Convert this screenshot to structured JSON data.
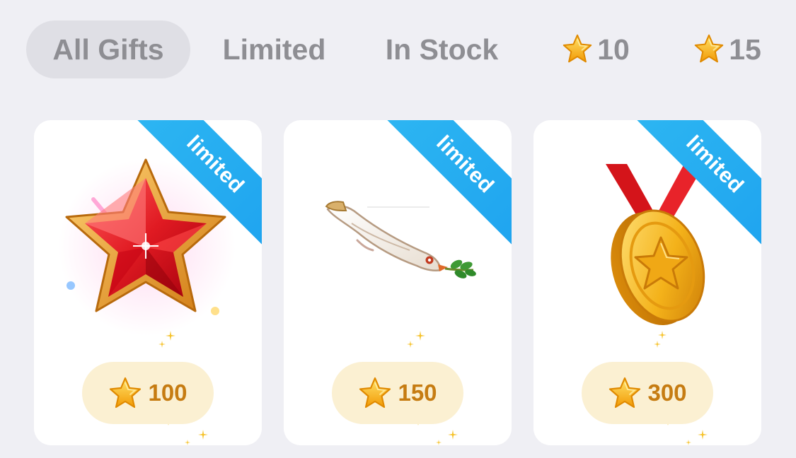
{
  "tabs": {
    "all_gifts": "All Gifts",
    "limited": "Limited",
    "in_stock": "In Stock",
    "star_10": "10",
    "star_15": "15"
  },
  "gifts": [
    {
      "badge": "limited",
      "price": "100",
      "item": "red-star-icon"
    },
    {
      "badge": "limited",
      "price": "150",
      "item": "dove-icon"
    },
    {
      "badge": "limited",
      "price": "300",
      "item": "gold-medal-icon"
    }
  ],
  "colors": {
    "background": "#efeff4",
    "active_tab": "#dfdfe5",
    "tab_text": "#8e8e93",
    "ribbon": "#1ea3ef",
    "price_pill": "#fbf0d2",
    "price_text": "#c67c12",
    "star": "#f7b500"
  }
}
